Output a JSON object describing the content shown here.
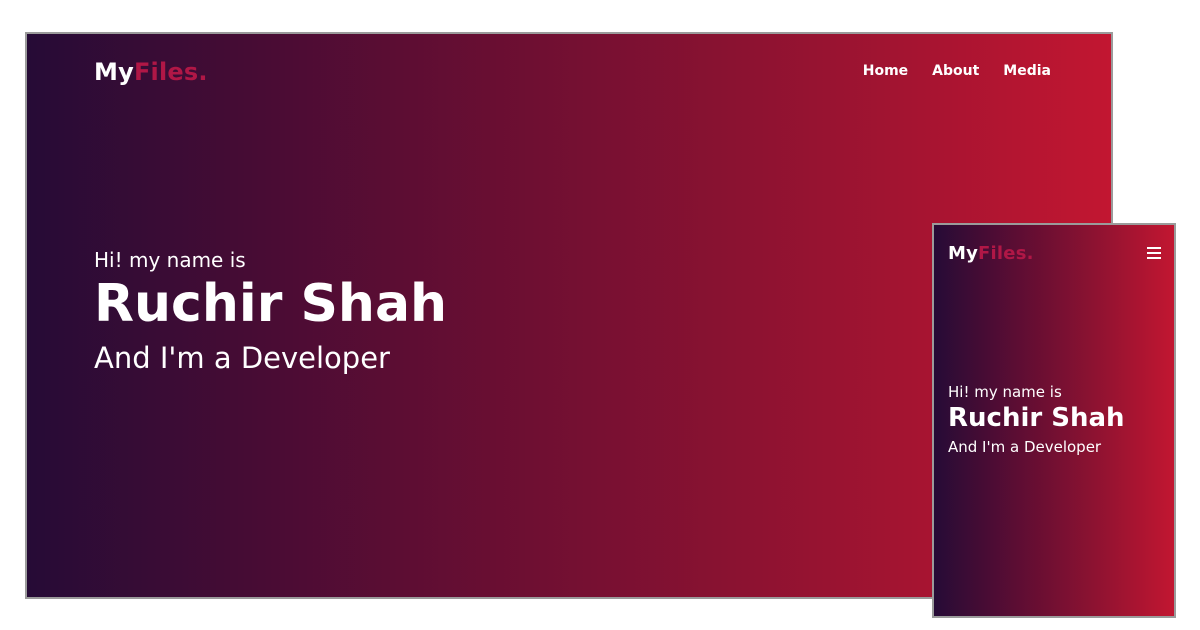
{
  "brand": {
    "logo_main": "My",
    "logo_accent": "Files.",
    "accent_color": "#b01746"
  },
  "nav": {
    "items": [
      {
        "label": "Home"
      },
      {
        "label": "About"
      },
      {
        "label": "Media"
      }
    ]
  },
  "hero": {
    "intro": "Hi! my name is",
    "name": "Ruchir Shah",
    "role": "And I'm a Developer"
  },
  "mobile_nav": {
    "menu_icon": "hamburger-menu-icon"
  },
  "theme": {
    "gradient_start": "#260b36",
    "gradient_end": "#c21631",
    "text_color": "#ffffff"
  }
}
